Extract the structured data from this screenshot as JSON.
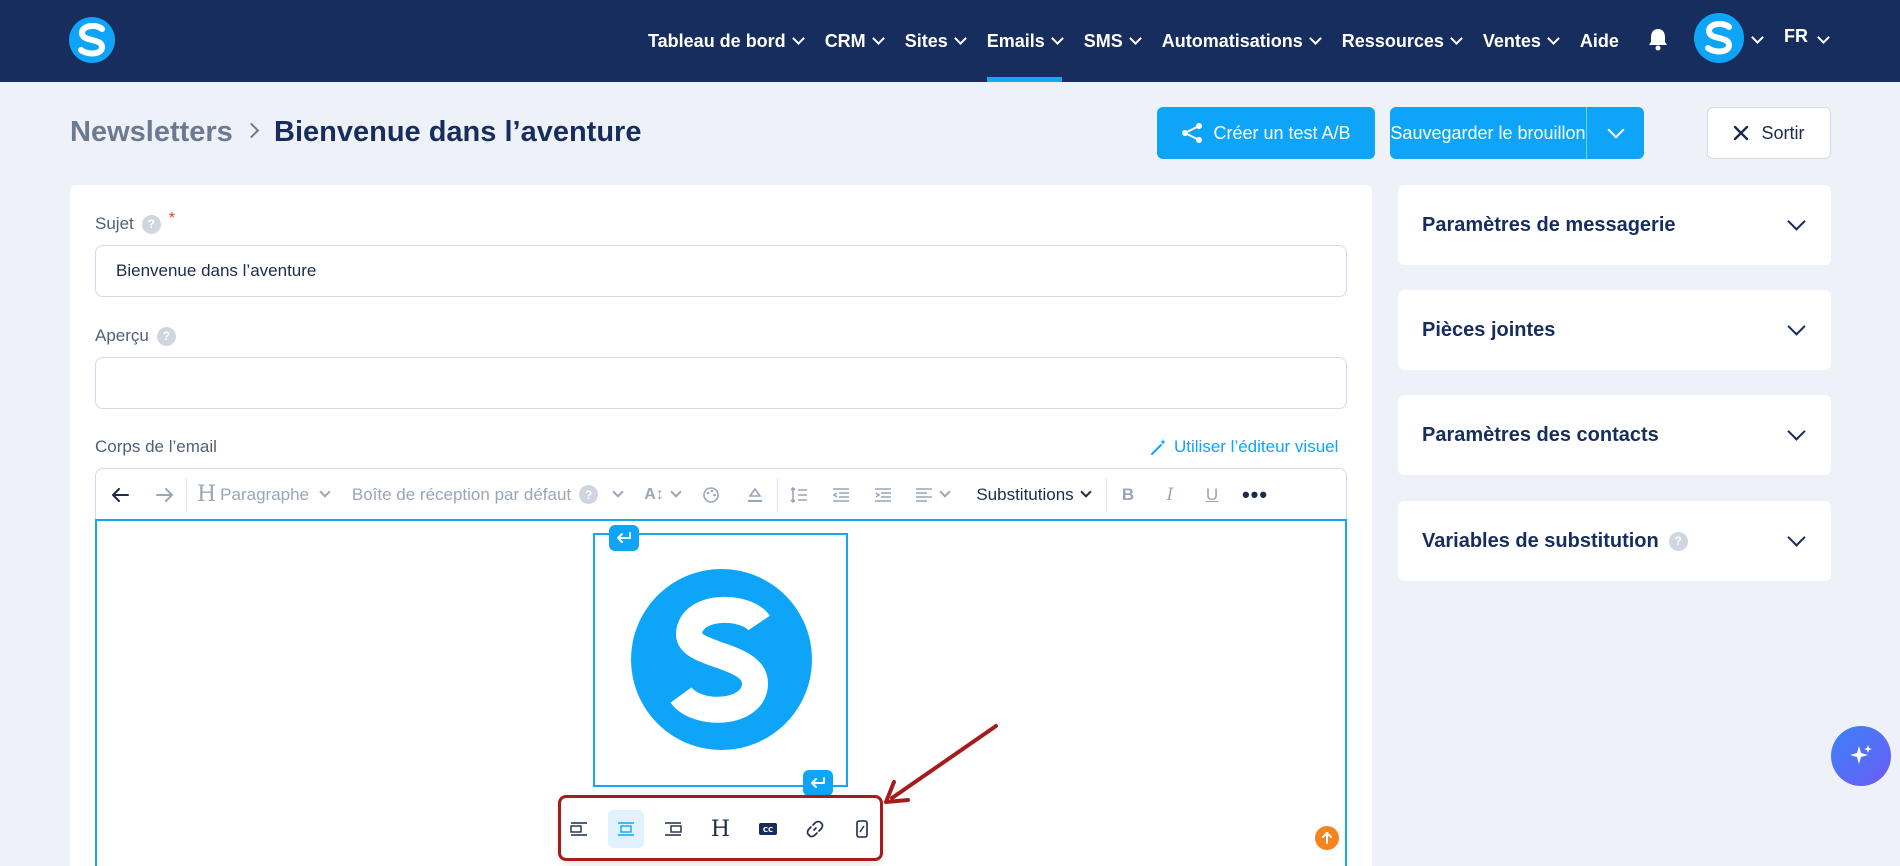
{
  "nav": {
    "items": [
      {
        "label": "Tableau de bord",
        "active": false
      },
      {
        "label": "CRM",
        "active": false
      },
      {
        "label": "Sites",
        "active": false
      },
      {
        "label": "Emails",
        "active": true
      },
      {
        "label": "SMS",
        "active": false
      },
      {
        "label": "Automatisations",
        "active": false
      },
      {
        "label": "Ressources",
        "active": false
      },
      {
        "label": "Ventes",
        "active": false
      },
      {
        "label": "Aide",
        "active": false
      }
    ],
    "language": "FR",
    "brand_color": "#0ea5f8",
    "nav_bg": "#172d5e"
  },
  "breadcrumb": {
    "parent": "Newsletters",
    "current": "Bienvenue dans l’aventure"
  },
  "actions": {
    "ab_test": "Créer un test A/B",
    "save_draft": "Sauvegarder le brouillon",
    "exit": "Sortir"
  },
  "form": {
    "subject_label": "Sujet",
    "subject_value": "Bienvenue dans l’aventure",
    "preview_label": "Aperçu",
    "preview_value": "",
    "body_label": "Corps de l’email",
    "visual_editor_link": "Utiliser l’éditeur visuel"
  },
  "toolbar": {
    "paragraph": "Paragraphe",
    "inbox": "Boîte de réception par défaut",
    "substitutions": "Substitutions"
  },
  "panels": [
    {
      "title": "Paramètres de messagerie",
      "help": false
    },
    {
      "title": "Pièces jointes",
      "help": false
    },
    {
      "title": "Paramètres des contacts",
      "help": false
    },
    {
      "title": "Variables de substitution",
      "help": true
    }
  ],
  "icons": {
    "image_toolbar": [
      "align-left-icon",
      "align-center-icon",
      "align-right-icon",
      "heading-icon",
      "caption-icon",
      "link-icon",
      "mobile-icon"
    ]
  },
  "highlight_color": "#a61c1c"
}
